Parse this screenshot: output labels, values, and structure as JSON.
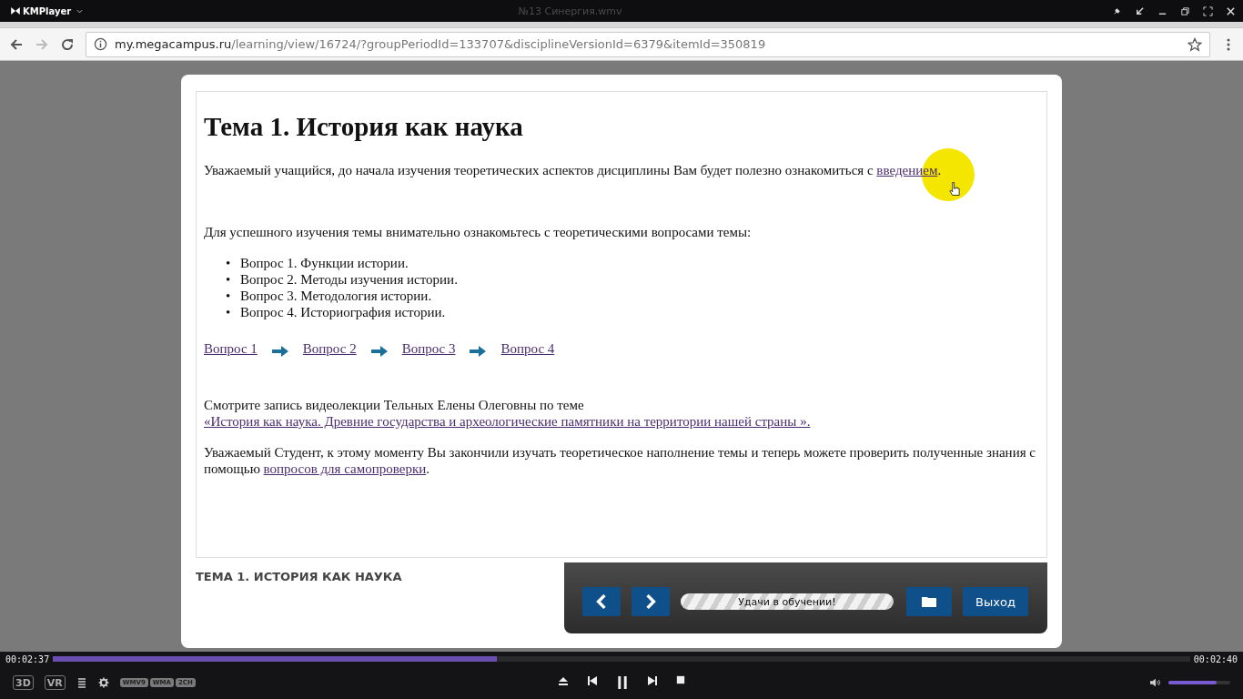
{
  "player": {
    "app_name": "KMPlayer",
    "file_title": "№13 Синергия.wmv",
    "time_elapsed": "00:02:37",
    "time_total": "00:02:40",
    "seek": {
      "level": 0.39
    },
    "volume": {
      "level": 0.78
    },
    "mode_buttons": [
      "3D",
      "VR"
    ],
    "badges": [
      "WMV9",
      "WMA",
      "2CH"
    ]
  },
  "browser": {
    "url": {
      "host": "my.megacampus.ru",
      "path": "/learning/view/16724/?groupPeriodId=133707&disciplineVersionId=6379&itemId=350819"
    }
  },
  "page": {
    "title": "Тема 1. История как наука",
    "intro": {
      "text": "Уважаемый учащийся, до начала изучения теоретических аспектов дисциплины Вам будет полезно ознакомиться с ",
      "link": "введением",
      "tail": "."
    },
    "lead": "Для успешного изучения темы внимательно ознакомьтесь с теоретическими вопросами темы:",
    "questions": [
      {
        "bullet": "•",
        "text": "Вопрос 1. Функции истории."
      },
      {
        "bullet": "•",
        "text": "Вопрос 2. Методы изучения истории."
      },
      {
        "bullet": "•",
        "text": "Вопрос 3. Методология истории."
      },
      {
        "bullet": "•",
        "text": "Вопрос 4. Историография истории."
      }
    ],
    "question_links": [
      "Вопрос 1",
      "Вопрос 2",
      "Вопрос 3",
      "Вопрос 4"
    ],
    "lecture": {
      "text": "Смотрите запись видеолекции Тельных Елены Олеговны по теме ",
      "link": "«История как наука. Древние государства и археологические памятники на территории нашей страны »."
    },
    "closing": {
      "text": "Уважаемый Студент, к этому моменту Вы закончили изучать теоретическое наполнение темы и теперь можете проверить полученные знания с помощью ",
      "link": "вопросов для самопроверки",
      "tail": "."
    },
    "footer_title": "ТЕМА 1. ИСТОРИЯ КАК НАУКА",
    "nav": {
      "message": "Удачи в обучении!",
      "exit_label": "Выход"
    }
  }
}
